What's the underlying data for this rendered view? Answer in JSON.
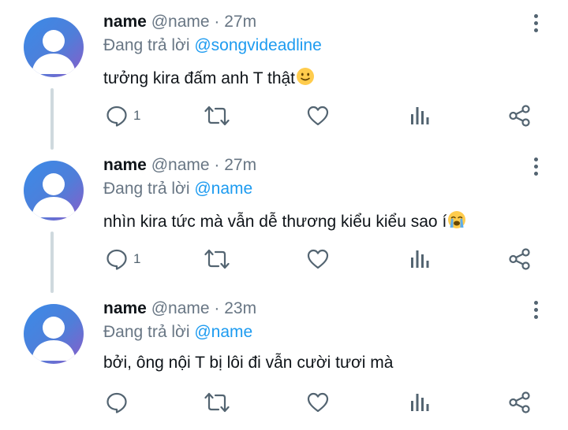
{
  "tweets": [
    {
      "name": "name",
      "handle": "@name",
      "separator": "·",
      "time": "27m",
      "reply_prefix": "Đang trả lời",
      "reply_to": "@songvideadline",
      "text": "tưởng kira đấm anh T thật",
      "emoji": "slightly-smiling-face",
      "reply_count": "1"
    },
    {
      "name": "name",
      "handle": "@name",
      "separator": "·",
      "time": "27m",
      "reply_prefix": "Đang trả lời",
      "reply_to": "@name",
      "text": "nhìn kira tức mà vẫn dễ thương kiểu kiểu sao í",
      "emoji": "loudly-crying-face",
      "reply_count": "1"
    },
    {
      "name": "name",
      "handle": "@name",
      "separator": "·",
      "time": "23m",
      "reply_prefix": "Đang trả lời",
      "reply_to": "@name",
      "text": "bởi, ông nội T bị lôi đi vẫn cười tươi mà",
      "emoji": "",
      "reply_count": ""
    }
  ],
  "icons": {
    "reply": "reply-icon",
    "retweet": "retweet-icon",
    "like": "heart-icon",
    "analytics": "analytics-icon",
    "share": "share-icon",
    "more": "more-vertical-icon"
  },
  "colors": {
    "name": "#0f1419",
    "secondary": "#687684",
    "mention": "#1d9bf0",
    "thread_line": "#cfd9de",
    "icon": "#536471"
  }
}
